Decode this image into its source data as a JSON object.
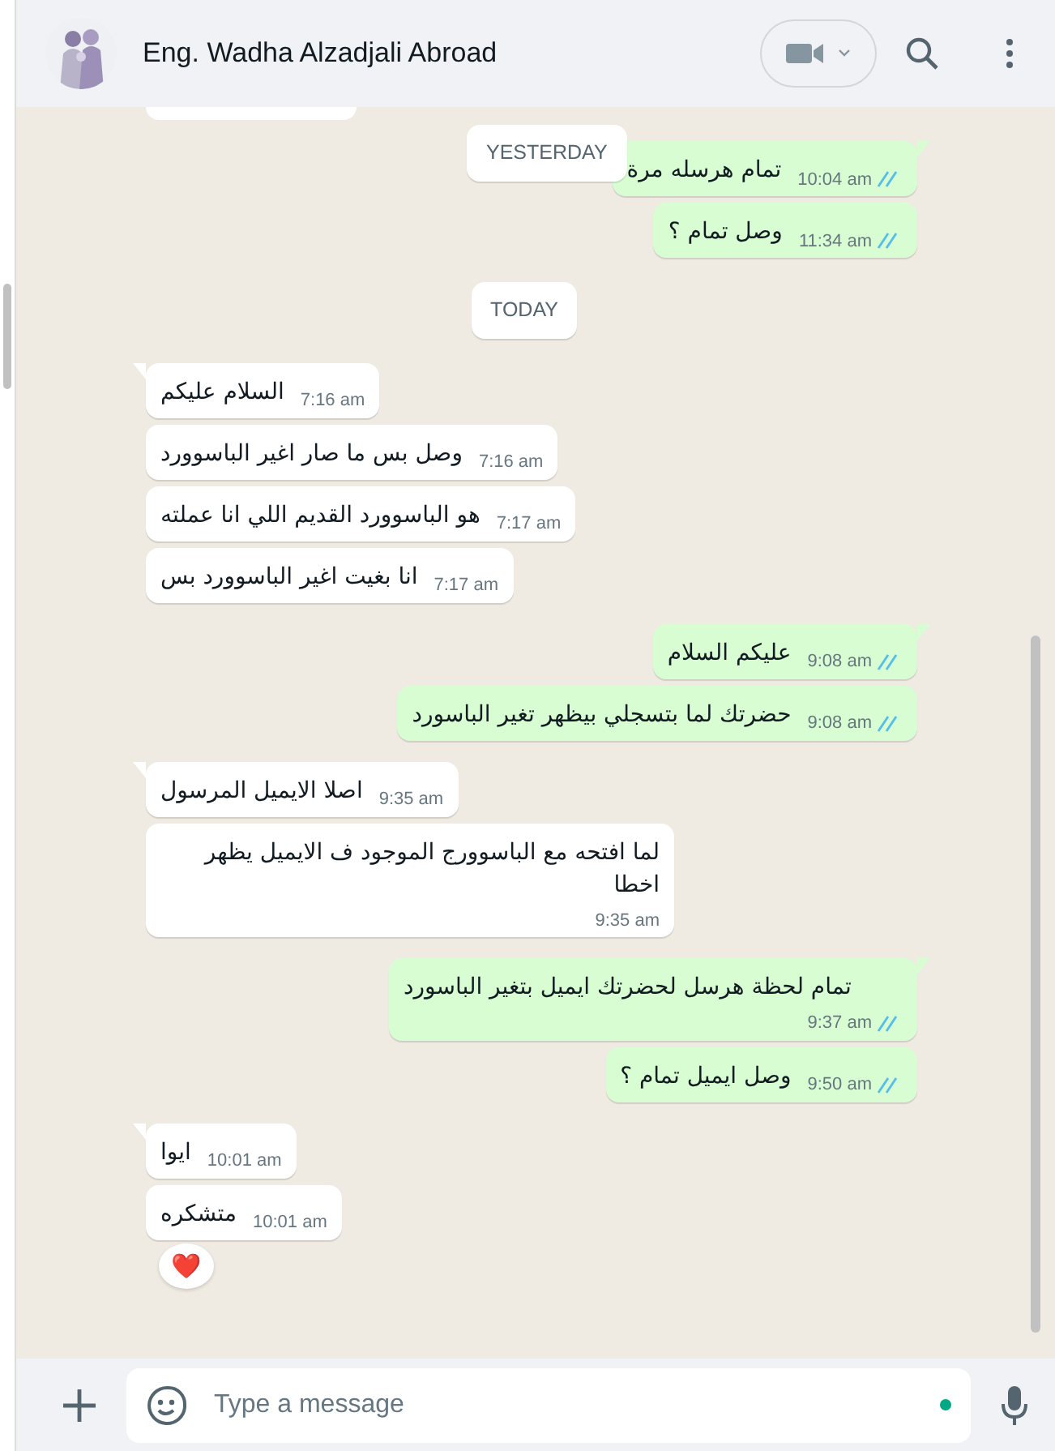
{
  "header": {
    "name": "Eng. Wadha Alzadjali Abroad"
  },
  "sticky_date": {
    "label": "YESTERDAY"
  },
  "messages": [
    {
      "kind": "out",
      "text": "تمام هرسله مرة",
      "time": "10:04 am",
      "read": true,
      "tail": true
    },
    {
      "kind": "out",
      "text": "وصل تمام ؟",
      "time": "11:34 am",
      "read": true,
      "tail": false
    },
    {
      "kind": "date",
      "label": "TODAY"
    },
    {
      "kind": "in",
      "text": "السلام عليكم",
      "time": "7:16 am",
      "tail": true
    },
    {
      "kind": "in",
      "text": "وصل بس ما صار اغير الباسوورد",
      "time": "7:16 am",
      "tail": false
    },
    {
      "kind": "in",
      "text": "هو الباسوورد القديم اللي انا عملته",
      "time": "7:17 am",
      "tail": false
    },
    {
      "kind": "in",
      "text": "انا بغيت اغير الباسوورد بس",
      "time": "7:17 am",
      "tail": false
    },
    {
      "kind": "out",
      "text": "عليكم السلام",
      "time": "9:08 am",
      "read": true,
      "tail": true
    },
    {
      "kind": "out",
      "text": "حضرتك لما بتسجلي بيظهر تغير الباسورد",
      "time": "9:08 am",
      "read": true,
      "tail": false
    },
    {
      "kind": "in",
      "text": "اصلا الايميل المرسول",
      "time": "9:35 am",
      "tail": true
    },
    {
      "kind": "in",
      "text": "لما افتحه مع الباسوورج الموجود ف الايميل يظهر اخطا",
      "time": "9:35 am",
      "tail": false
    },
    {
      "kind": "out",
      "text": "تمام لحظة هرسل لحضرتك ايميل بتغير الباسورد",
      "time": "9:37 am",
      "read": true,
      "tail": true
    },
    {
      "kind": "out",
      "text": "وصل ايميل تمام ؟",
      "time": "9:50 am",
      "read": true,
      "tail": false
    },
    {
      "kind": "in",
      "text": "ايوا",
      "time": "10:01 am",
      "tail": true
    },
    {
      "kind": "in",
      "text": "متشكره",
      "time": "10:01 am",
      "tail": false,
      "reaction": "❤️"
    }
  ],
  "composer": {
    "placeholder": "Type a message"
  }
}
